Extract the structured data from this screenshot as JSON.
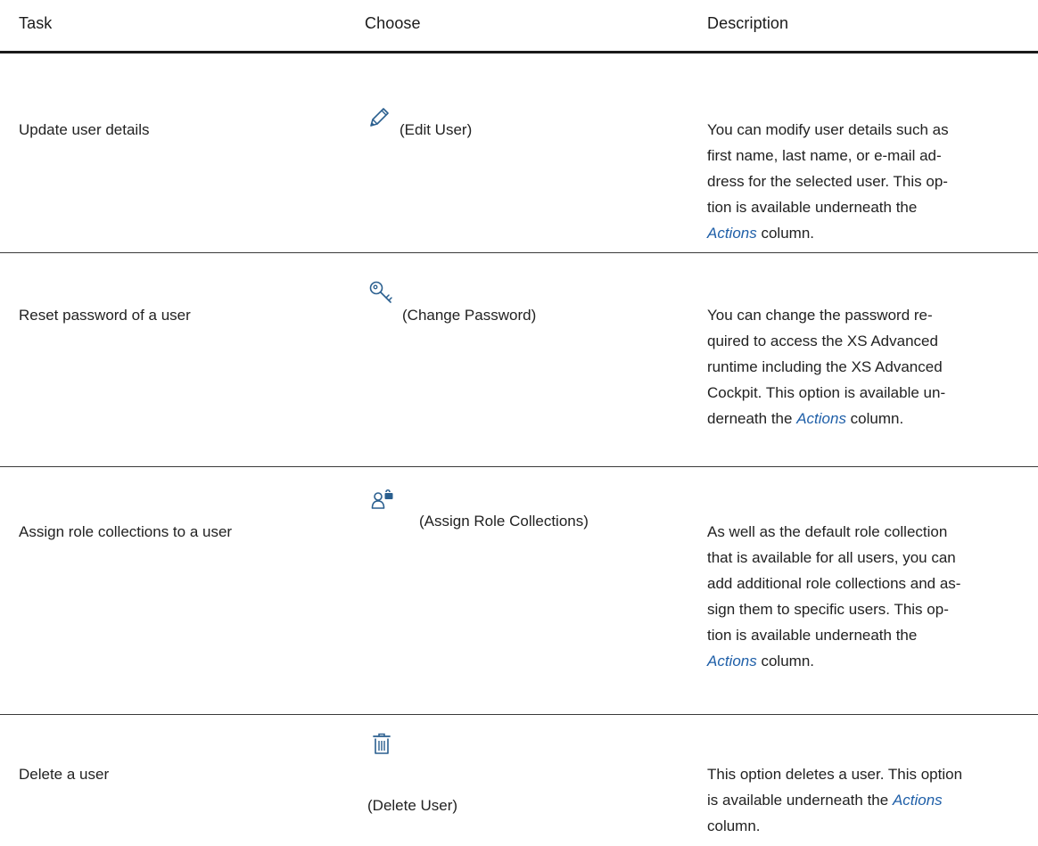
{
  "header": {
    "task": "Task",
    "choose": "Choose",
    "description": "Description"
  },
  "rows": [
    {
      "task": "Update user details",
      "choose_label": "(Edit User)",
      "icon": "pencil-icon",
      "desc_lines": [
        "You can modify user details such as",
        "first name, last name, or e-mail ad-",
        "dress for the selected user. This op-",
        "tion is available underneath the"
      ],
      "desc_link": "Actions",
      "desc_tail": " column."
    },
    {
      "task": "Reset password of a user",
      "choose_label": "(Change Password)",
      "icon": "key-icon",
      "desc_lines": [
        "You can change the password re-",
        "quired to access the XS Advanced",
        "runtime including the XS Advanced",
        "Cockpit. This option is available un-"
      ],
      "desc_prefix": "derneath the ",
      "desc_link": "Actions",
      "desc_tail": " column."
    },
    {
      "task": "Assign role collections to a user",
      "choose_label": "(Assign Role Collections)",
      "icon": "user-unlock-icon",
      "desc_lines": [
        "As well as the default role collection",
        "that is available for all users, you can",
        "add additional role collections and as-",
        "sign them to specific users. This op-",
        "tion is available underneath the"
      ],
      "desc_link": "Actions",
      "desc_tail": " column."
    },
    {
      "task": "Delete a user",
      "choose_label": "(Delete User)",
      "icon": "trash-icon",
      "desc_lines": [
        "This option deletes a user. This option"
      ],
      "desc_prefix": "is available underneath the ",
      "desc_link": "Actions",
      "desc_tail": "column."
    }
  ]
}
